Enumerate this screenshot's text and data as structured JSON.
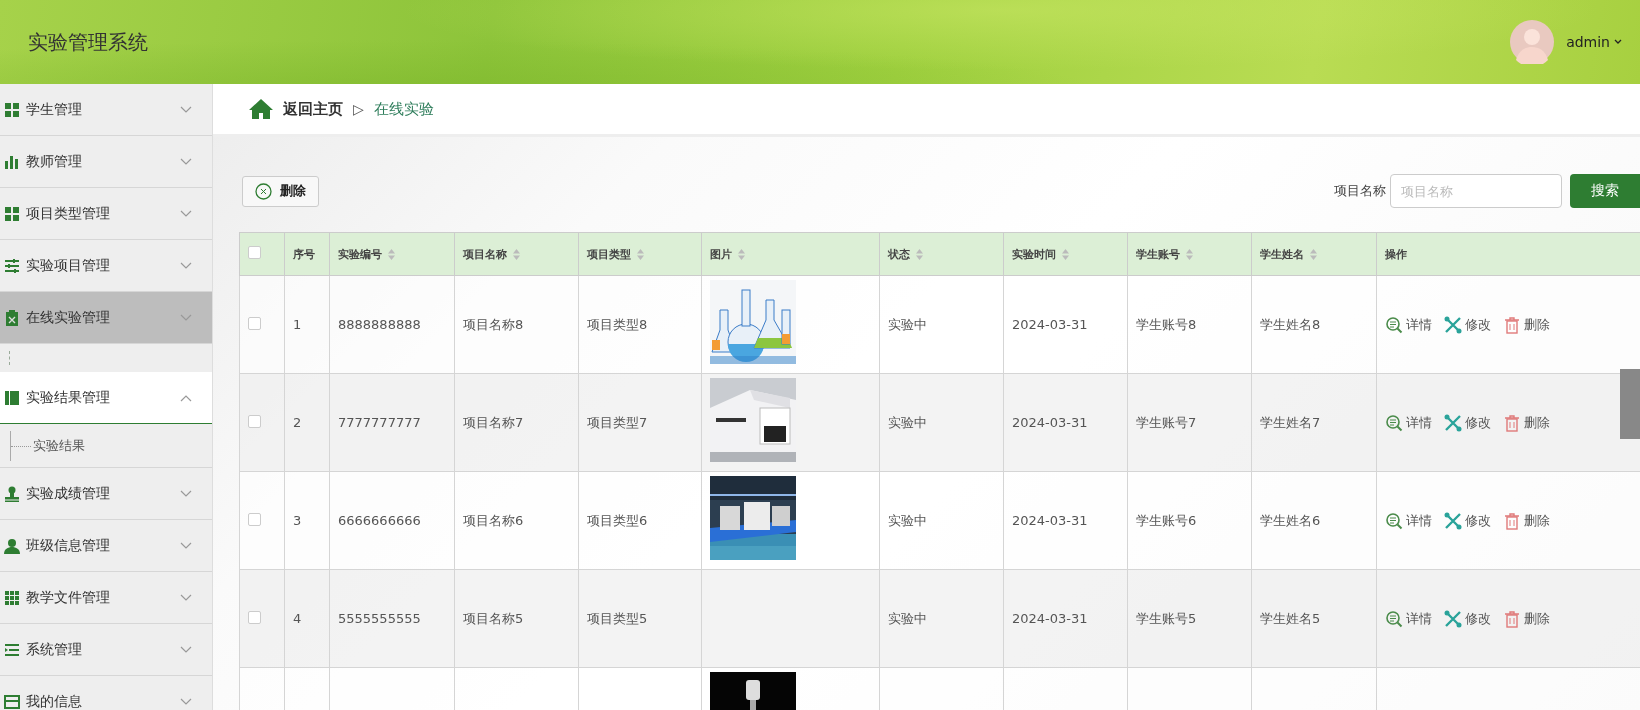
{
  "header": {
    "title": "实验管理系统",
    "user": "admin"
  },
  "sidebar": {
    "items": [
      {
        "label": "学生管理",
        "kind": "grid",
        "selected": false,
        "expanded": false
      },
      {
        "label": "教师管理",
        "kind": "bars",
        "selected": false,
        "expanded": false
      },
      {
        "label": "项目类型管理",
        "kind": "grid",
        "selected": false,
        "expanded": false
      },
      {
        "label": "实验项目管理",
        "kind": "sliders",
        "selected": false,
        "expanded": false
      },
      {
        "label": "在线实验管理",
        "kind": "clipboard",
        "selected": true,
        "expanded": false,
        "closing": true
      },
      {
        "label": "实验结果管理",
        "kind": "book",
        "selected": false,
        "expanded": true,
        "children": [
          {
            "label": "实验结果"
          }
        ]
      },
      {
        "label": "实验成绩管理",
        "kind": "stamp",
        "selected": false,
        "expanded": false
      },
      {
        "label": "班级信息管理",
        "kind": "person",
        "selected": false,
        "expanded": false
      },
      {
        "label": "教学文件管理",
        "kind": "grid9",
        "selected": false,
        "expanded": false
      },
      {
        "label": "系统管理",
        "kind": "list",
        "selected": false,
        "expanded": false
      },
      {
        "label": "我的信息",
        "kind": "card",
        "selected": false,
        "expanded": false
      }
    ]
  },
  "breadcrumb": {
    "home": "返回主页",
    "separator": "▷",
    "current": "在线实验"
  },
  "toolbar": {
    "delete": "删除",
    "search_label": "项目名称",
    "search_placeholder": "项目名称",
    "search_button": "搜索"
  },
  "table": {
    "all_checked": false,
    "columns": [
      {
        "label": "序号",
        "sortable": false
      },
      {
        "label": "实验编号",
        "sortable": true
      },
      {
        "label": "项目名称",
        "sortable": true
      },
      {
        "label": "项目类型",
        "sortable": true
      },
      {
        "label": "图片",
        "sortable": true
      },
      {
        "label": "状态",
        "sortable": true
      },
      {
        "label": "实验时间",
        "sortable": true
      },
      {
        "label": "学生账号",
        "sortable": true
      },
      {
        "label": "学生姓名",
        "sortable": true
      },
      {
        "label": "操作",
        "sortable": false
      }
    ],
    "rows": [
      {
        "checked": false,
        "cells": [
          "1",
          "8888888888",
          "项目名称8",
          "项目类型8"
        ],
        "image": {
          "kind": "picture"
        },
        "cells2": [
          "实验中",
          "2024-03-31",
          "学生账号8",
          "学生姓名8"
        ],
        "actions": [
          "详情",
          "修改",
          "删除"
        ]
      },
      {
        "checked": false,
        "cells": [
          "2",
          "7777777777",
          "项目名称7",
          "项目类型7"
        ],
        "image": {
          "kind": "picture"
        },
        "cells2": [
          "实验中",
          "2024-03-31",
          "学生账号7",
          "学生姓名7"
        ],
        "actions": [
          "详情",
          "修改",
          "删除"
        ]
      },
      {
        "checked": false,
        "cells": [
          "3",
          "6666666666",
          "项目名称6",
          "项目类型6"
        ],
        "image": {
          "kind": "picture"
        },
        "cells2": [
          "实验中",
          "2024-03-31",
          "学生账号6",
          "学生姓名6"
        ],
        "actions": [
          "详情",
          "修改",
          "删除"
        ]
      },
      {
        "checked": false,
        "cells": [
          "4",
          "5555555555",
          "项目名称5",
          "项目类型5"
        ],
        "image": {
          "kind": "broken"
        },
        "cells2": [
          "实验中",
          "2024-03-31",
          "学生账号5",
          "学生姓名5"
        ],
        "actions": [
          "详情",
          "修改",
          "删除"
        ]
      },
      {
        "kind": "partial",
        "image": {
          "kind": "picture"
        }
      }
    ]
  }
}
